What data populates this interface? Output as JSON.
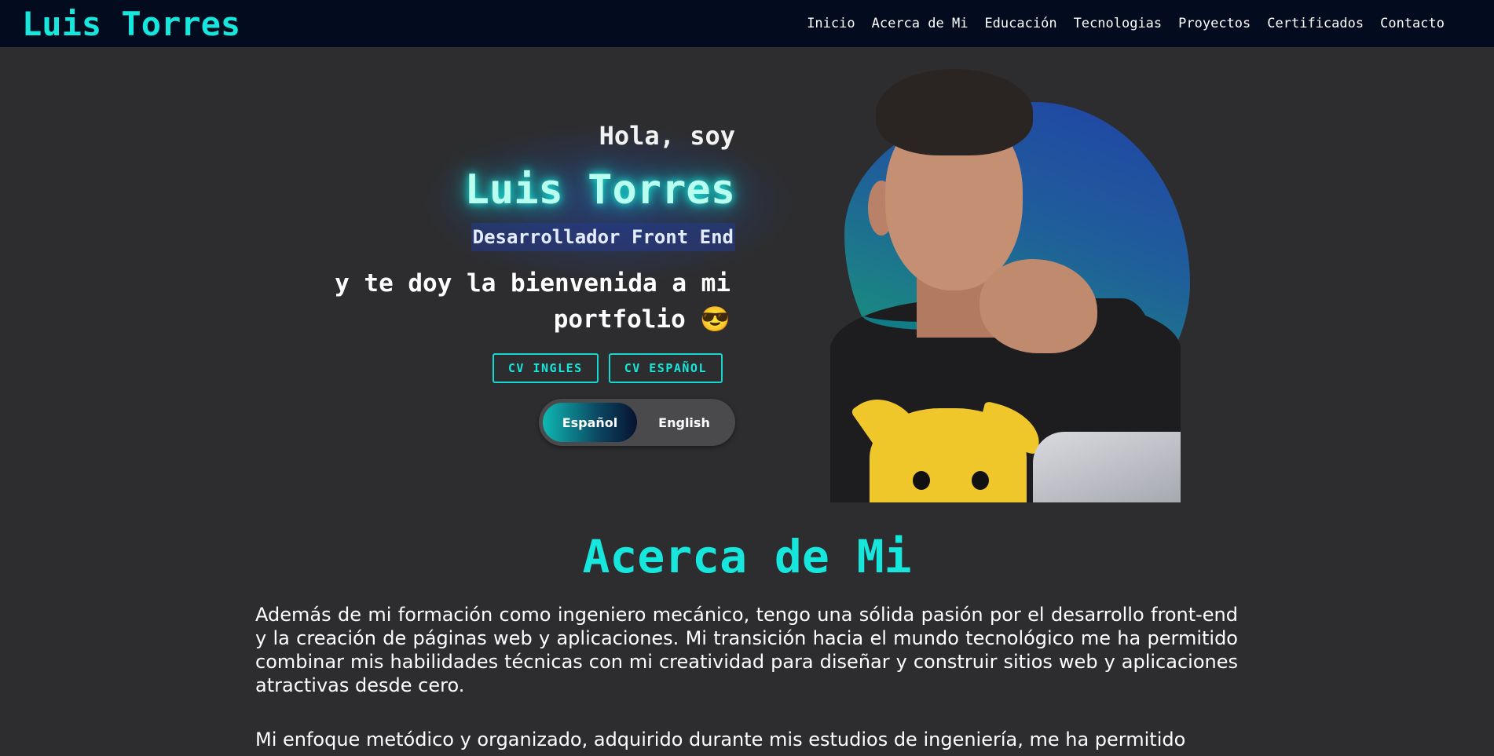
{
  "navbar": {
    "brand": "Luis Torres",
    "links": [
      "Inicio",
      "Acerca de Mi",
      "Educación",
      "Tecnologias",
      "Proyectos",
      "Certificados",
      "Contacto"
    ]
  },
  "hero": {
    "greeting": "Hola, soy",
    "name": "Luis Torres",
    "role": "Desarrollador Front End",
    "welcome_line1": "y te doy la bienvenida a mi",
    "welcome_line2": "portfolio 😎",
    "cv_english": "CV INGLES",
    "cv_spanish": "CV ESPAÑOL",
    "lang_active": "Español",
    "lang_other": "English"
  },
  "about": {
    "title": "Acerca de Mi",
    "paragraph1": "Además de mi formación como ingeniero mecánico, tengo una sólida pasión por el desarrollo front-end y la creación de páginas web y aplicaciones. Mi transición hacia el mundo tecnológico me ha permitido combinar mis habilidades técnicas con mi creatividad para diseñar y construir sitios web y aplicaciones atractivas desde cero.",
    "paragraph2": "Mi enfoque metódico y organizado, adquirido durante mis estudios de ingeniería, me ha permitido"
  },
  "colors": {
    "accent": "#16e6dc",
    "navbar_bg": "#030b1f",
    "page_bg": "#2d2d2f"
  }
}
